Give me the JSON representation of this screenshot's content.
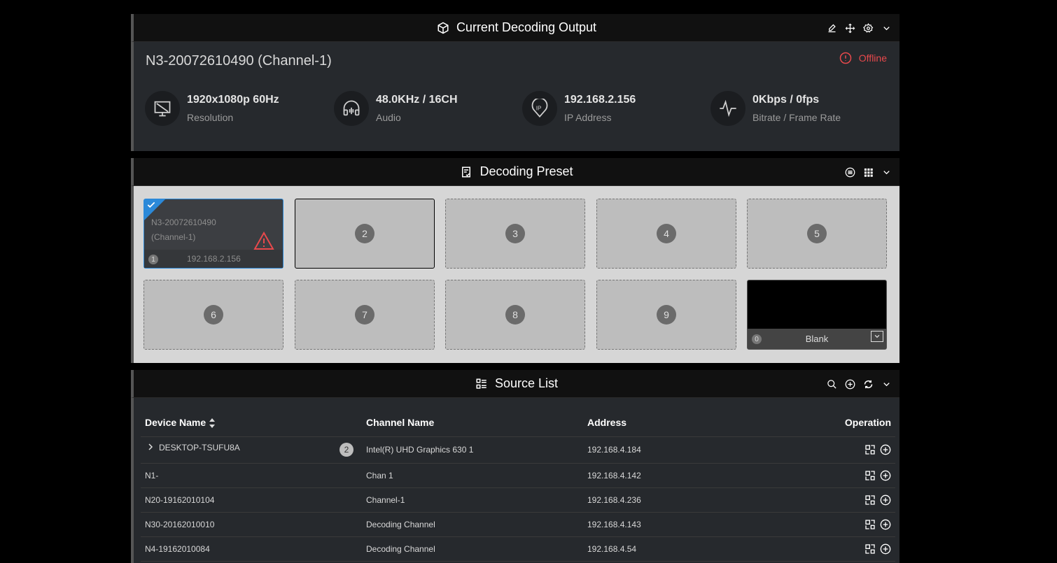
{
  "output": {
    "title": "Current Decoding Output",
    "device": "N3-20072610490 (Channel-1)",
    "status": "Offline",
    "colors": {
      "offline": "#e8494c",
      "accent": "#2b89d9"
    },
    "stats": [
      {
        "icon": "monitor-icon",
        "value": "1920x1080p 60Hz",
        "label": "Resolution"
      },
      {
        "icon": "headphones-icon",
        "value": "48.0KHz / 16CH",
        "label": "Audio"
      },
      {
        "icon": "ip-location-icon",
        "value": "192.168.2.156",
        "label": "IP Address"
      },
      {
        "icon": "pulse-icon",
        "value": "0Kbps / 0fps",
        "label": "Bitrate / Frame Rate"
      }
    ]
  },
  "preset": {
    "title": "Decoding Preset",
    "active": {
      "line1": "N3-20072610490",
      "line2": "(Channel-1)",
      "index": "1",
      "ip": "192.168.2.156"
    },
    "slots": [
      "2",
      "3",
      "4",
      "5",
      "6",
      "7",
      "8",
      "9"
    ],
    "blank": {
      "index": "0",
      "label": "Blank"
    }
  },
  "source": {
    "title": "Source List",
    "columns": {
      "device": "Device Name",
      "channel": "Channel Name",
      "address": "Address",
      "operation": "Operation"
    },
    "rows": [
      {
        "device": "DESKTOP-TSUFU8A",
        "count": "2",
        "channel": "Intel(R) UHD Graphics 630 1",
        "address": "192.168.4.184"
      },
      {
        "device": "N1-",
        "channel": "Chan 1",
        "address": "192.168.4.142"
      },
      {
        "device": "N20-19162010104",
        "channel": "Channel-1",
        "address": "192.168.4.236"
      },
      {
        "device": "N30-20162010010",
        "channel": "Decoding Channel",
        "address": "192.168.4.143"
      },
      {
        "device": "N4-19162010084",
        "channel": "Decoding Channel",
        "address": "192.168.4.54"
      }
    ]
  }
}
